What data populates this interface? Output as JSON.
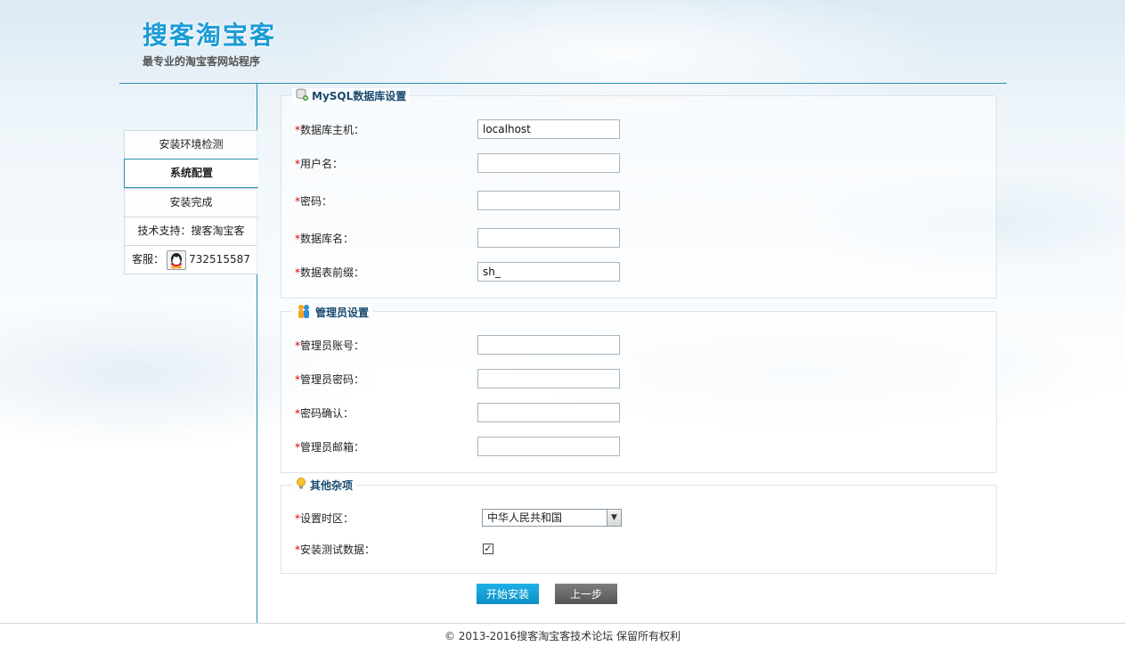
{
  "header": {
    "logo_title": "搜客淘宝客",
    "logo_subtitle": "最专业的淘宝客网站程序"
  },
  "sidebar": {
    "items": [
      {
        "label": "安装环境检测"
      },
      {
        "label": "系统配置"
      },
      {
        "label": "安装完成"
      },
      {
        "label": "技术支持：搜客淘宝客"
      }
    ],
    "service_label": "客服：",
    "service_qq": "732515587"
  },
  "mysql": {
    "legend": "MySQL数据库设置",
    "fields": [
      {
        "label": "数据库主机：",
        "value": "localhost"
      },
      {
        "label": "用户名：",
        "value": ""
      },
      {
        "label": "密码：",
        "value": ""
      },
      {
        "label": "数据库名：",
        "value": ""
      },
      {
        "label": "数据表前缀：",
        "value": "sh_"
      }
    ]
  },
  "admin": {
    "legend": "管理员设置",
    "fields": [
      {
        "label": "管理员账号：",
        "value": ""
      },
      {
        "label": "管理员密码：",
        "value": ""
      },
      {
        "label": "密码确认：",
        "value": ""
      },
      {
        "label": "管理员邮箱：",
        "value": ""
      }
    ]
  },
  "other": {
    "legend": "其他杂项",
    "timezone_label": "设置时区：",
    "timezone_value": "中华人民共和国",
    "testdata_label": "安装测试数据：",
    "testdata_checked": true
  },
  "buttons": {
    "start": "开始安装",
    "prev": "上一步"
  },
  "footer": "© 2013-2016搜客淘宝客技术论坛 保留所有权利",
  "required_mark": "*",
  "colors": {
    "accent": "#1b9bd6",
    "line": "#2a8fb2",
    "start_button": "#0c8fc4",
    "prev_button": "#555555",
    "required": "#dd0000"
  }
}
